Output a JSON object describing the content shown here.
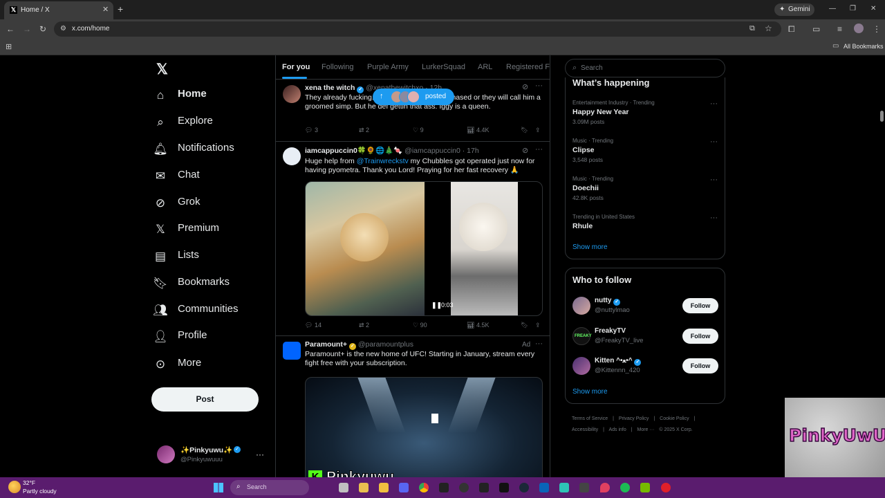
{
  "browser": {
    "tab_title": "Home / X",
    "url": "x.com/home",
    "gemini_label": "Gemini",
    "bookmarks_label": "All Bookmarks"
  },
  "nav": {
    "items": [
      {
        "label": "Home",
        "icon": "home-icon"
      },
      {
        "label": "Explore",
        "icon": "search-icon"
      },
      {
        "label": "Notifications",
        "icon": "bell-icon"
      },
      {
        "label": "Chat",
        "icon": "mail-icon"
      },
      {
        "label": "Grok",
        "icon": "grok-icon"
      },
      {
        "label": "Premium",
        "icon": "x-logo-icon"
      },
      {
        "label": "Lists",
        "icon": "list-icon"
      },
      {
        "label": "Bookmarks",
        "icon": "bookmark-icon"
      },
      {
        "label": "Communities",
        "icon": "people-icon"
      },
      {
        "label": "Profile",
        "icon": "person-icon"
      },
      {
        "label": "More",
        "icon": "more-circle-icon"
      }
    ],
    "post_label": "Post",
    "account": {
      "name": "✨Pinkyuwu✨",
      "handle": "@Pinkyuwuuu"
    }
  },
  "feed": {
    "tabs": [
      "For you",
      "Following",
      "Purple Army",
      "LurkerSquad",
      "ARL",
      "Registered Fle"
    ],
    "new_posts_pill": "posted",
    "tweets": [
      {
        "name": "xena the witch",
        "handle": "@xenathewitchxo · 12h",
        "text": "They already fucking... ga so he gotta act unphased or they will call him a groomed simp. But he def gettin that ass. Iggy is a queen.",
        "replies": "3",
        "reposts": "2",
        "likes": "9",
        "views": "4.4K"
      },
      {
        "name": "iamcappuccin0🍀🌻🌐🎄🍬",
        "handle": "@iamcappuccin0 · 17h",
        "text_a": "Huge help from ",
        "mention": "@Trainwreckstv",
        "text_b": " my Chubbles  got operated just now for having pyometra. Thank you Lord! Praying for her fast recovery 🙏",
        "video_time": "0:03",
        "replies": "14",
        "reposts": "2",
        "likes": "90",
        "views": "4.5K"
      },
      {
        "name": "Paramount+",
        "handle": "@paramountplus",
        "ad_label": "Ad",
        "text": "Paramount+ is the new home of UFC! Starting in January, stream every fight free with your subscription."
      }
    ]
  },
  "sidebar": {
    "search_placeholder": "Search",
    "happening_title": "What’s happening",
    "trends": [
      {
        "category": "Entertainment Industry · Trending",
        "name": "Happy New Year",
        "count": "3.09M posts"
      },
      {
        "category": "Music · Trending",
        "name": "Clipse",
        "count": "3,548 posts"
      },
      {
        "category": "Music · Trending",
        "name": "Doechii",
        "count": "42.8K posts"
      },
      {
        "category": "Trending in United States",
        "name": "Rhule",
        "count": ""
      }
    ],
    "show_more": "Show more",
    "follow_title": "Who to follow",
    "follow": [
      {
        "name": "nutty",
        "handle": "@nuttylmao",
        "button": "Follow"
      },
      {
        "name": "FreakyTV",
        "handle": "@FreakyTV_live",
        "button": "Follow"
      },
      {
        "name": "Kitten ^•ﻌ•^",
        "handle": "@Kittennn_420",
        "button": "Follow"
      }
    ],
    "footer": [
      "Terms of Service",
      "|",
      "Privacy Policy",
      "|",
      "Cookie Policy",
      "|",
      "Accessibility",
      "|",
      "Ads info",
      "|",
      "More ···",
      "© 2025 X Corp."
    ]
  },
  "overlay": {
    "streamer_name": "Pinkyuwu",
    "logo_text": "PinkyUwU"
  },
  "taskbar": {
    "weather_temp": "32°F",
    "weather_desc": "Partly cloudy",
    "search_label": "Search"
  }
}
